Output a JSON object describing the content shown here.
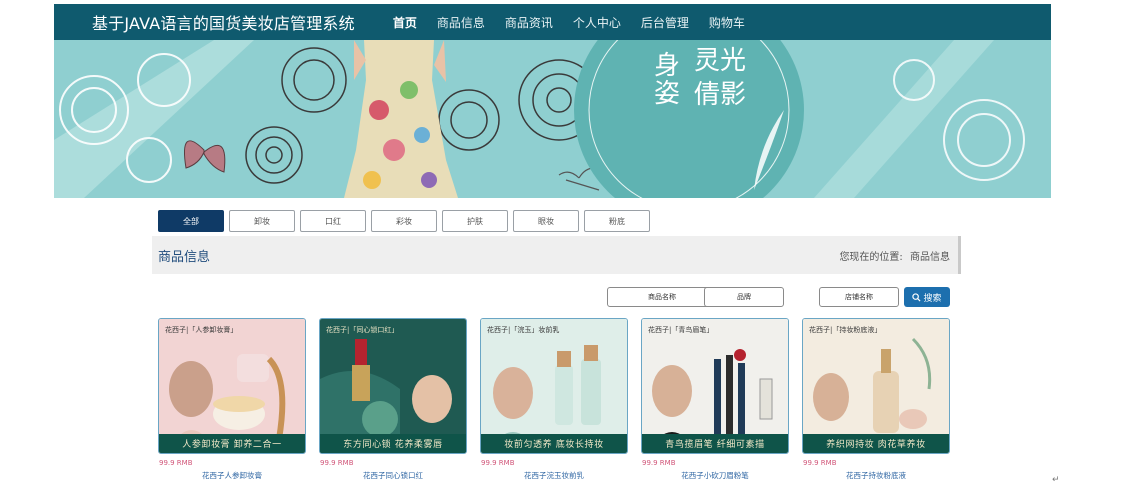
{
  "header": {
    "site_title": "基于JAVA语言的国货美妆店管理系统",
    "nav": [
      "首页",
      "商品信息",
      "商品资讯",
      "个人中心",
      "后台管理",
      "购物车"
    ],
    "active_index": 0
  },
  "banner": {
    "headline_line1": "身姿",
    "headline_line2": "灵光倩影",
    "slide_count": 2,
    "active_slide": 0
  },
  "categories": {
    "items": [
      "全部",
      "卸妆",
      "口红",
      "彩妆",
      "护肤",
      "眼妆",
      "粉底"
    ],
    "active_index": 0
  },
  "section": {
    "title": "商品信息",
    "breadcrumb_label": "您现在的位置:",
    "breadcrumb_current": "商品信息"
  },
  "search": {
    "name_placeholder": "商品名称",
    "brand_placeholder": "品牌",
    "shop_placeholder": "店铺名称",
    "button_label": "搜索"
  },
  "products": [
    {
      "brand_line": "花西子|「人参卸妆膏」",
      "caption": "人参卸妆膏 卸养二合一",
      "price": "99.9 RMB",
      "name": "花西子人参卸妆膏"
    },
    {
      "brand_line": "花西子|「同心锁口红」",
      "caption": "东方同心锁 花养柔雾唇",
      "price": "99.9 RMB",
      "name": "花西子同心锁口红"
    },
    {
      "brand_line": "花西子|「浣玉」妆前乳",
      "caption": "妆前匀透养 底妆长持妆",
      "price": "99.9 RMB",
      "name": "花西子浣玉妆前乳"
    },
    {
      "brand_line": "花西子|「青鸟眉笔」",
      "caption": "青鸟揽眉笔 纤细可素描",
      "price": "99.9 RMB",
      "name": "花西子小砍刀眉粉笔"
    },
    {
      "brand_line": "花西子|「持妆粉底液」",
      "caption": "养织网持妆 肉花草养妆",
      "price": "99.9 RMB",
      "name": "花西子持妆粉底液"
    }
  ],
  "colors": {
    "header_bg": "#0f5a6e",
    "banner_bg": "#8fcfd0",
    "active_tab": "#0f3a66",
    "search_button": "#1d6fae",
    "price": "#d1577a",
    "product_name": "#2f66a3",
    "card_caption_bg": "#0f5449"
  },
  "icons": {
    "search": "search-icon",
    "return_mark": "↵"
  }
}
